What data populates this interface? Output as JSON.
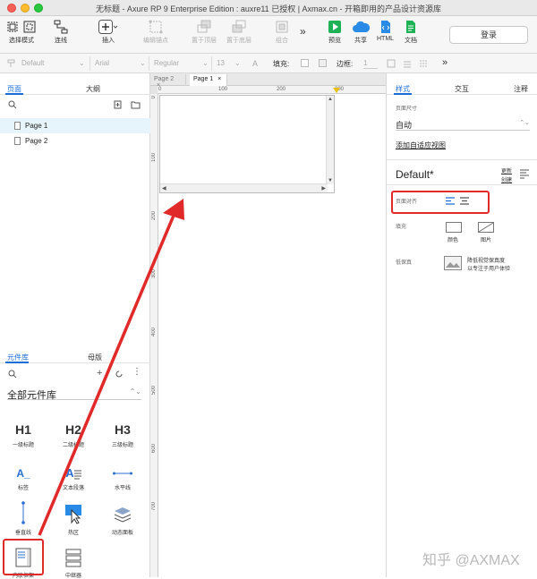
{
  "window": {
    "title": "无标题 - Axure RP 9 Enterprise Edition : auxre11 已授权 | Axmax.cn - 开箱即用的产品设计资源库"
  },
  "toolbar": {
    "select_mode": "选择模式",
    "connect": "连线",
    "insert": "插入",
    "edit_points": "编辑锚点",
    "bring_front": "置于顶层",
    "send_back": "置于底层",
    "combine": "组合",
    "more": "»",
    "preview": "预览",
    "share": "共享",
    "html": "HTML",
    "docs": "文档",
    "login": "登录"
  },
  "format_bar": {
    "style": "Default",
    "font": "Arial",
    "weight": "Regular",
    "size": "13",
    "fill_label": "填充:",
    "border_label": "边框:",
    "border_value": "1",
    "more": "»"
  },
  "left_panel": {
    "tabs": [
      "页面",
      "大纲"
    ],
    "pages": [
      "Page 1",
      "Page 2"
    ],
    "lib_tabs": [
      "元件库",
      "母版"
    ],
    "library_name": "全部元件库",
    "widgets": [
      {
        "glyph": "H1",
        "label": "一级标题"
      },
      {
        "glyph": "H2",
        "label": "二级标题"
      },
      {
        "glyph": "H3",
        "label": "三级标题"
      },
      {
        "glyph": "A_",
        "label": "标签"
      },
      {
        "glyph": "A",
        "label": "文本段落"
      },
      {
        "glyph": "",
        "label": "水平线"
      },
      {
        "glyph": "",
        "label": "垂直线"
      },
      {
        "glyph": "",
        "label": "热区"
      },
      {
        "glyph": "",
        "label": "动态面板"
      },
      {
        "glyph": "",
        "label": "内联框架"
      },
      {
        "glyph": "",
        "label": "中继器"
      }
    ]
  },
  "canvas": {
    "tabs": [
      "Page 2",
      "Page 1"
    ],
    "ruler_top": [
      "0",
      "100",
      "200",
      "300"
    ],
    "ruler_left": [
      "100",
      "200",
      "300",
      "400",
      "500",
      "600",
      "700"
    ]
  },
  "right_panel": {
    "tabs": [
      "样式",
      "交互",
      "注释"
    ],
    "page_size_label": "页面尺寸",
    "page_size_value": "自动",
    "adaptive_link": "添加自适应视图",
    "style_name": "Default*",
    "update_label": "更新",
    "create_label": "创建",
    "align_label": "页面对齐",
    "fill_label": "填充",
    "color_label": "颜色",
    "image_label": "图片",
    "fidelity_label": "低保真",
    "fidelity_desc1": "降低视觉保真度",
    "fidelity_desc2": "以专注于用户体验"
  },
  "watermark": "知乎 @AXMAX",
  "colors": {
    "accent": "#1a6ed8",
    "annotation": "#e02a2a",
    "preview_green": "#1fb155",
    "share_blue": "#2a8be6"
  }
}
